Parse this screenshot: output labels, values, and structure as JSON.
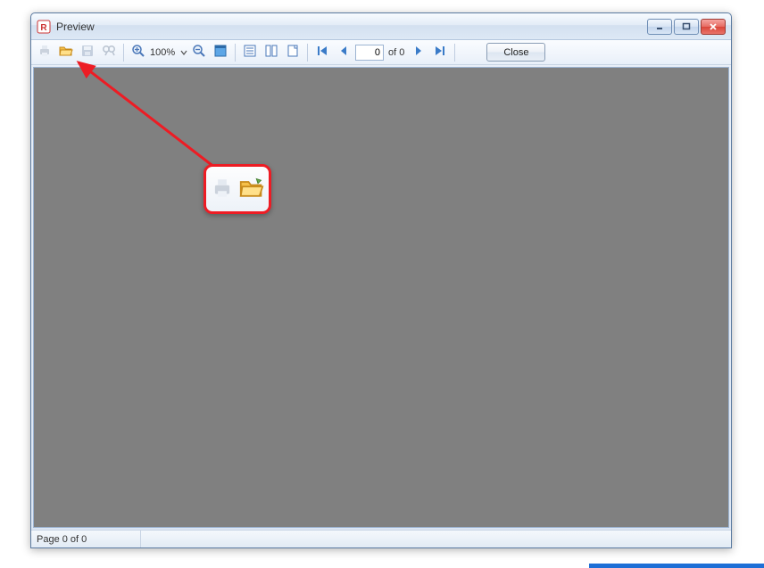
{
  "window": {
    "title": "Preview"
  },
  "toolbar": {
    "zoom_value": "100%",
    "page_input_value": "0",
    "page_of_label": "of 0",
    "close_label": "Close"
  },
  "statusbar": {
    "page_text": "Page 0 of 0"
  },
  "icons": {
    "print": "print-icon",
    "open": "open-folder-icon",
    "save": "save-icon",
    "find": "find-icon",
    "zoom_in": "zoom-in-icon",
    "zoom_out": "zoom-out-icon",
    "fullscreen": "fullscreen-icon",
    "outline": "outline-icon",
    "thumbnails": "thumbnails-icon",
    "page_setup": "page-setup-icon",
    "first": "first-page-icon",
    "prev": "prev-page-icon",
    "next": "next-page-icon",
    "last": "last-page-icon"
  },
  "colors": {
    "annotation_red": "#ed1c24",
    "canvas_gray": "#808080"
  }
}
